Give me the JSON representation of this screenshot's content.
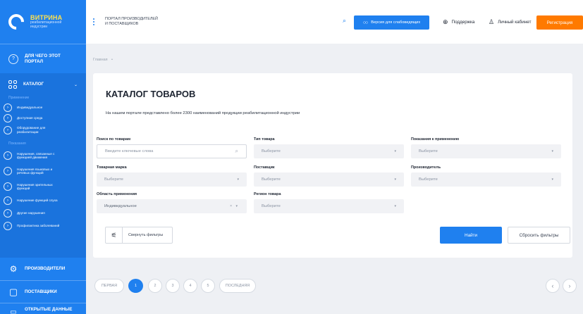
{
  "brand": {
    "title": "ВИТРИНА",
    "subtitle_line1": "реабилитационной",
    "subtitle_line2": "индустрии"
  },
  "sidebar": {
    "about_line1": "ДЛЯ ЧЕГО ЭТОТ",
    "about_line2": "ПОРТАЛ",
    "catalog_label": "КАТАЛОГ",
    "catalog_chevron": "⌄",
    "groups": [
      {
        "label": "Применение",
        "items": [
          {
            "label1": "Индивидуальное",
            "label2": ""
          },
          {
            "label1": "Доступная среда",
            "label2": ""
          },
          {
            "label1": "Оборудование для",
            "label2": "реабилитации"
          }
        ]
      },
      {
        "label": "Показания",
        "items": [
          {
            "label1": "Нарушения, связанные с",
            "label2": "функцией движения"
          },
          {
            "label1": "Нарушения языковых и",
            "label2": "речевых функций"
          },
          {
            "label1": "Нарушения зрительных",
            "label2": "функций"
          },
          {
            "label1": "Нарушение функций слуха",
            "label2": ""
          },
          {
            "label1": "Другие нарушения",
            "label2": ""
          },
          {
            "label1": "Профилактика заболеваний",
            "label2": ""
          }
        ]
      }
    ],
    "manufacturers_label": "ПРОИЗВОДИТЕЛИ",
    "suppliers_label": "ПОСТАВЩИКИ",
    "opendata_label": "ОТКРЫТЫЕ ДАННЫЕ"
  },
  "header": {
    "portal_line1": "ПОРТАЛ ПРОИЗВОДИТЕЛЕЙ",
    "portal_line2": "И ПОСТАВЩИКОВ",
    "vision_label": "Версия для слабовидящих",
    "support_label": "Поддержка",
    "cabinet_label": "Личный кабинет",
    "register_label": "Регистрация"
  },
  "breadcrumb": {
    "home": "Главная",
    "sep": "•"
  },
  "catalog": {
    "title": "КАТАЛОГ ТОВАРОВ",
    "description": "На нашем портале представлено более 2300 наименований продукции реабилитационной индустрии",
    "filters": {
      "search": {
        "label": "Поиск по товарам",
        "placeholder": "Введите ключевые слова"
      },
      "type": {
        "label": "Тип товара",
        "value": "Выберите"
      },
      "indications": {
        "label": "Показания к применению",
        "value": "Выберите"
      },
      "brand": {
        "label": "Товарная марка",
        "value": "Выберите"
      },
      "supplier": {
        "label": "Поставщик",
        "value": "Выберите"
      },
      "manufacturer": {
        "label": "Производитель",
        "value": "Выберите"
      },
      "area": {
        "label": "Область применения",
        "value": "Индивидуальное",
        "clear": "× ▾"
      },
      "region": {
        "label": "Регион товара",
        "value": "Выберите"
      }
    },
    "collapse_label": "Свернуть фильтры",
    "find_label": "Найти",
    "reset_label": "Сбросить фильтры"
  },
  "pagination": {
    "first": "ПЕРВАЯ",
    "pages": [
      "1",
      "2",
      "3",
      "4",
      "5"
    ],
    "last": "ПОСЛЕДНЯЯ",
    "current": "1",
    "prev_icon": "‹",
    "next_icon": "›"
  },
  "colors": {
    "accent": "#1f80ef",
    "sidebar": "#1f80ef",
    "sidebar_active": "#1a73dd",
    "cta": "#ff7a00",
    "brand_yellow": "#ffe14d"
  },
  "icons": {
    "search": "⌕",
    "info": "?",
    "arrow": "›",
    "gear": "⚙",
    "box": "▢",
    "globe": "⊕",
    "person": "♙",
    "glasses": "○○",
    "filter": "⚟",
    "chevron": "▾"
  }
}
